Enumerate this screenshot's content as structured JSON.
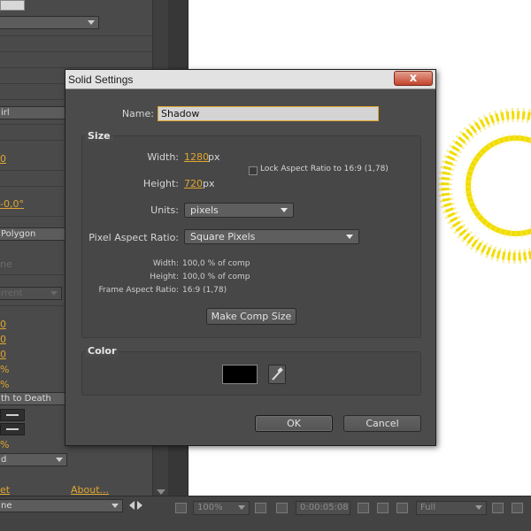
{
  "left_panel": {
    "rows": [
      {
        "text": "irl"
      },
      {
        "text": "0"
      },
      {
        "text": "-0,0°"
      },
      {
        "text": "Polygon"
      },
      {
        "text": "ne"
      },
      {
        "text": "rrent"
      },
      {
        "text": "0"
      },
      {
        "text": "0"
      },
      {
        "text": "0"
      },
      {
        "text": "%"
      },
      {
        "text": "%"
      },
      {
        "text": "th to Death"
      },
      {
        "text": "%"
      },
      {
        "text": "d"
      },
      {
        "text": "et"
      },
      {
        "text": "About..."
      },
      {
        "text": "ne"
      }
    ]
  },
  "viewer_toolbar": {
    "zoom": "100%",
    "timecode": "0:00:05:08",
    "resolution": "Full"
  },
  "dialog": {
    "title": "Solid Settings",
    "close_label": "x",
    "name_label": "Name:",
    "name_value": "Shadow",
    "size_group": "Size",
    "width_label": "Width:",
    "width_value": "1280",
    "height_label": "Height:",
    "height_value": "720",
    "px": "px",
    "lock_label": "Lock Aspect Ratio to 16:9 (1,78)",
    "lock_checked": false,
    "units_label": "Units:",
    "units_value": "pixels",
    "par_label": "Pixel Aspect Ratio:",
    "par_value": "Square Pixels",
    "info_width_label": "Width:",
    "info_width_value": "100,0 % of comp",
    "info_height_label": "Height:",
    "info_height_value": "100,0 % of comp",
    "far_label": "Frame Aspect Ratio:",
    "far_value": "16:9 (1,78)",
    "make_comp_size": "Make Comp Size",
    "color_group": "Color",
    "color_value": "#000000",
    "ok": "OK",
    "cancel": "Cancel"
  },
  "colors": {
    "accent_orange": "#e0a631",
    "ring_yellow": "#f2dd00"
  }
}
